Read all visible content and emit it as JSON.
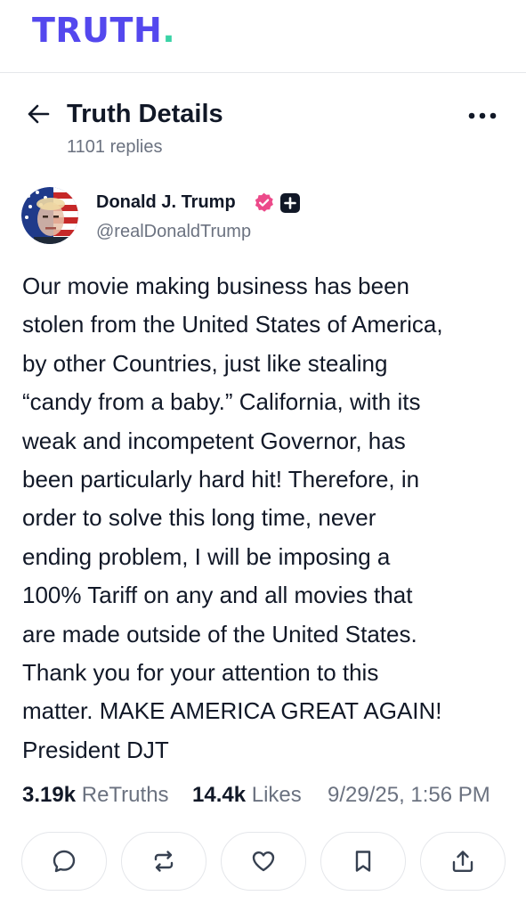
{
  "brand": {
    "logo_text": "TRUTH",
    "logo_dot": ".",
    "colors": {
      "logo": "#5448ee",
      "logo_dot": "#3ad3a6"
    }
  },
  "header": {
    "back_icon": "arrow-left-icon",
    "title": "Truth Details",
    "replies": "1101 replies",
    "more_icon": "more-horizontal-icon"
  },
  "author": {
    "name": "Donald J. Trump",
    "handle": "@realDonaldTrump",
    "badges": [
      "verified-badge-icon",
      "plus-badge-icon"
    ],
    "verified_color": "#ec4a8a"
  },
  "post": {
    "text": "Our movie making business has been\nstolen from the United States of America,\nby other Countries, just like stealing\n“candy from a baby.” California, with its\nweak and incompetent Governor, has\nbeen particularly hard hit! Therefore, in\norder to solve this long time, never\nending problem, I will be imposing a\n100% Tariff on any and all movies that\nare made outside of the United States.\nThank you for your attention to this\nmatter. MAKE AMERICA GREAT AGAIN!\nPresident DJT"
  },
  "stats": {
    "retruths_count": "3.19k",
    "retruths_label": "ReTruths",
    "likes_count": "14.4k",
    "likes_label": "Likes",
    "timestamp": "9/29/25, 1:56 PM"
  },
  "actions": [
    {
      "name": "reply",
      "icon": "comment-icon"
    },
    {
      "name": "retruth",
      "icon": "repost-icon"
    },
    {
      "name": "like",
      "icon": "heart-icon"
    },
    {
      "name": "bookmark",
      "icon": "bookmark-icon"
    },
    {
      "name": "share",
      "icon": "share-icon"
    }
  ]
}
